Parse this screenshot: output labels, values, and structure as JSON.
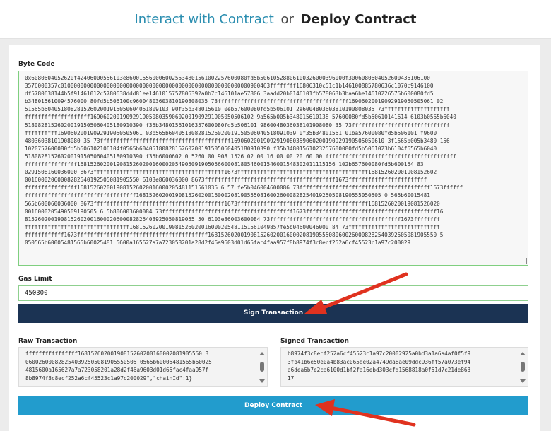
{
  "header": {
    "interact_label": "Interact with Contract",
    "or_label": "or",
    "deploy_label": "Deploy Contract"
  },
  "bytecode": {
    "label": "Byte Code",
    "lines": [
      "0x6080604052620f42406000556103e8600155600060025534801561002257600080fd5b50610528806100326000396000f3006080604052600436106100",
      "3576000357c0100000000000000000000000000000000000000000000000000000000900463ffffffff16806310c51c1b146100885780636c1070c9146100",
      "df5780638144b5f91461012c5780638ddd81ee1461015757806392a0b7c146101ae57806 3aadd20b0146101fb578063b3baa6be14610226575b600080fd5",
      "b348015610094576000 80fd5b506100c96004803603810190808035 73ffffffffffffffffffffffffffffffffffffffff16906020019092919050505061 02",
      "51565b60405180828152602001915050604051809103 90f35b348015610 0eb57600080fd5b506101 2a6004803603810190808035 73ffffffffffffffffffff",
      "ffffffffffffffffffff16906020019092919050803590602001909291905050506102 9a565b005b348015610138 57600080fd5b50610141614 6103b0565b6040",
      "518082815260200191505060405180910390 f35b34801561016357600080fd5b506101 9860048036038101908080 35 73ffffffffffffffffffffffffffffff",
      "ffffffffff16906020019092919050505061 03b565b604051808281526020019150506040518091039 0f35b34801561 01ba57600080fd5b506101 f9600",
      "48036038101908080 35 73ffffffffffffffffffffffffffffffffffffffff16906020019092919080359060200190929190505050610 3f1565b005b3480 156",
      "1020757600080fd5b506102106104f0565b6040518082815260200191505060405180910390 f35b34801561023257600080fd5b5061023b6104f6565b6040",
      "518082815260200191505060405180910390 f35b6000602 0 5260 00 908 1526 02 00 16 00 00 20 60 00 ffffffffffffffffffffffffffffffffffffffff",
      "ffffffffffffffff1681526020019081526020016000205490509190505660008180546001546001548302011115156 102b657600080fd5b600154 83",
      "0291508160036000 8673ffffffffffffffffffffffffffffffffffffffff1673ffffffffffffffffffffffffffffffffffffffff168152602001908152602",
      "00160002060008282540192505081905550 6103e860036000 8673ffffffffffffffffffffffffffffffffffffffff1673ffffffffffffffffffffffff",
      "ffffffffffffffff1681526020019081526020016000205481151561035 6 57 fe5b046004600086 73ffffffffffffffffffffffffffffffffffffffff1673ffffff",
      "ffffffffffffffffffffffffffffffffff168152602001908152602001600020819055508160026000828254019250508190555050505 0 565b60015481",
      "565b600060036000 8673ffffffffffffffffffffffffffffffffffffffff1673ffffffffffffffffffffffffffffffffffffffff1681526020019081526020",
      "0016000205490509190505 6 5b806003600084 73ffffffffffffffffffffffffffffffffffffffff1673ffffffffffffffffffffffffffffffffffffffff16",
      "8152602001908152602001600020600082825403925050819055 50 6103e86003600084 73ffffffffffffffffffffffffffffffffffffffff1673ffffffff",
      "ffffffffffffffffffffffffffffffff1681526020019081526020016000205481151561049857fe5b04600046000 84 73ffffffffffffffffffffffffffff",
      "ffffffffffff1673ffffffffffffffffffffffffffffffffffffffff1681526020019081526020016000208190555080600260008282540392505081905550 5",
      "050565b60005481565b60025481 5600a165627a7a723058201a28d2f46a9603d01d65fac4faa957f8b8974f3c8ecf252a6cf45523c1a97c200029"
    ]
  },
  "gas": {
    "label": "Gas Limit",
    "value": "450300"
  },
  "sign_button": "Sign Transaction",
  "raw": {
    "label": "Raw Transaction",
    "lines": [
      "ffffffffffffffff16815260200190815260200160002081905550 8",
      "0600260008282540392505081905550505 0565b60005481565b60025",
      "4815600a165627a7a723058201a28d2f46a9603d01d65fac4faa957f",
      "8b8974f3c8ecf252a6cf45523c1a97c200029\",\"chainId\":1}"
    ]
  },
  "signed": {
    "label": "Signed Transaction",
    "lines": [
      "b8974f3c8ecf252a6cf45523c1a97c20002925a0bd3a1a6a4af0f5f9",
      "3fb41b6e50e0a4b83ac065de02a4749da8ae09ddc936ff57a073ef94",
      "a6dea6b7e2ca6100d1bf2fa16ebd303cfd1568818a0f51d7c21de863",
      "17"
    ]
  },
  "deploy_button": "Deploy Contract",
  "colors": {
    "accent": "#2b8eb0",
    "sign_button_bg": "#1b3353",
    "deploy_button_bg": "#229ccd",
    "arrow": "#e0321f"
  }
}
